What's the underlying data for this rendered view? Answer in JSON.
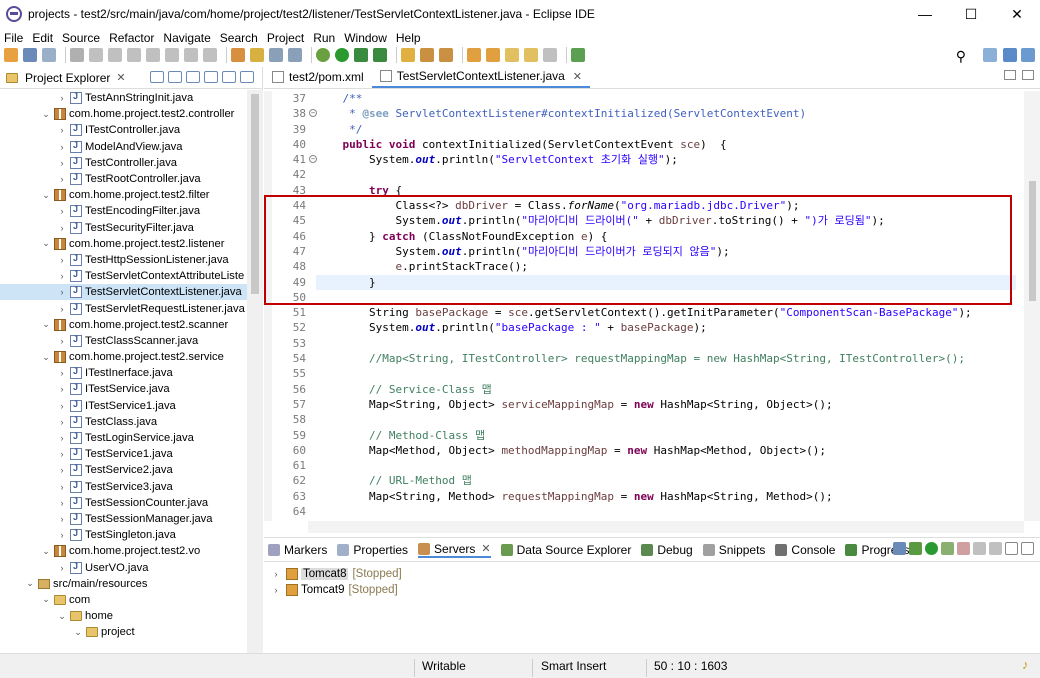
{
  "window": {
    "title": "projects - test2/src/main/java/com/home/project/test2/listener/TestServletContextListener.java - Eclipse IDE",
    "minimize": "—",
    "maximize": "☐",
    "close": "✕"
  },
  "menu": [
    "File",
    "Edit",
    "Source",
    "Refactor",
    "Navigate",
    "Search",
    "Project",
    "Run",
    "Window",
    "Help"
  ],
  "explorer": {
    "title": "Project Explorer",
    "items": [
      {
        "label": "TestAnnStringInit.java",
        "type": "java",
        "indent": 6,
        "twisty": "›"
      },
      {
        "label": "com.home.project.test2.controller",
        "type": "pkg",
        "indent": 4,
        "twisty": "⌄"
      },
      {
        "label": "ITestController.java",
        "type": "java",
        "indent": 6,
        "twisty": "›"
      },
      {
        "label": "ModelAndView.java",
        "type": "java",
        "indent": 6,
        "twisty": "›"
      },
      {
        "label": "TestController.java",
        "type": "java",
        "indent": 6,
        "twisty": "›"
      },
      {
        "label": "TestRootController.java",
        "type": "java",
        "indent": 6,
        "twisty": "›"
      },
      {
        "label": "com.home.project.test2.filter",
        "type": "pkg",
        "indent": 4,
        "twisty": "⌄"
      },
      {
        "label": "TestEncodingFilter.java",
        "type": "java",
        "indent": 6,
        "twisty": "›"
      },
      {
        "label": "TestSecurityFilter.java",
        "type": "java",
        "indent": 6,
        "twisty": "›"
      },
      {
        "label": "com.home.project.test2.listener",
        "type": "pkg",
        "indent": 4,
        "twisty": "⌄"
      },
      {
        "label": "TestHttpSessionListener.java",
        "type": "java",
        "indent": 6,
        "twisty": "›"
      },
      {
        "label": "TestServletContextAttributeListe",
        "type": "java",
        "indent": 6,
        "twisty": "›"
      },
      {
        "label": "TestServletContextListener.java",
        "type": "java",
        "indent": 6,
        "twisty": "›",
        "selected": true
      },
      {
        "label": "TestServletRequestListener.java",
        "type": "java",
        "indent": 6,
        "twisty": "›"
      },
      {
        "label": "com.home.project.test2.scanner",
        "type": "pkg",
        "indent": 4,
        "twisty": "⌄"
      },
      {
        "label": "TestClassScanner.java",
        "type": "java",
        "indent": 6,
        "twisty": "›"
      },
      {
        "label": "com.home.project.test2.service",
        "type": "pkg",
        "indent": 4,
        "twisty": "⌄"
      },
      {
        "label": "ITestInerface.java",
        "type": "java",
        "indent": 6,
        "twisty": "›"
      },
      {
        "label": "ITestService.java",
        "type": "java",
        "indent": 6,
        "twisty": "›"
      },
      {
        "label": "ITestService1.java",
        "type": "java",
        "indent": 6,
        "twisty": "›"
      },
      {
        "label": "TestClass.java",
        "type": "java",
        "indent": 6,
        "twisty": "›"
      },
      {
        "label": "TestLoginService.java",
        "type": "java",
        "indent": 6,
        "twisty": "›"
      },
      {
        "label": "TestService1.java",
        "type": "java",
        "indent": 6,
        "twisty": "›"
      },
      {
        "label": "TestService2.java",
        "type": "java",
        "indent": 6,
        "twisty": "›"
      },
      {
        "label": "TestService3.java",
        "type": "java",
        "indent": 6,
        "twisty": "›"
      },
      {
        "label": "TestSessionCounter.java",
        "type": "java",
        "indent": 6,
        "twisty": "›"
      },
      {
        "label": "TestSessionManager.java",
        "type": "java",
        "indent": 6,
        "twisty": "›"
      },
      {
        "label": "TestSingleton.java",
        "type": "java",
        "indent": 6,
        "twisty": "›"
      },
      {
        "label": "com.home.project.test2.vo",
        "type": "pkg",
        "indent": 4,
        "twisty": "⌄"
      },
      {
        "label": "UserVO.java",
        "type": "java",
        "indent": 6,
        "twisty": "›"
      },
      {
        "label": "src/main/resources",
        "type": "src",
        "indent": 2,
        "twisty": "⌄"
      },
      {
        "label": "com",
        "type": "folder",
        "indent": 4,
        "twisty": "⌄"
      },
      {
        "label": "home",
        "type": "folder",
        "indent": 6,
        "twisty": "⌄"
      },
      {
        "label": "project",
        "type": "folder",
        "indent": 8,
        "twisty": "⌄"
      }
    ]
  },
  "editor": {
    "tabs": [
      {
        "label": "test2/pom.xml",
        "active": false
      },
      {
        "label": "TestServletContextListener.java",
        "active": true
      }
    ],
    "line_numbers": [
      "37",
      "38",
      "39",
      "40",
      "41",
      "42",
      "43",
      "44",
      "45",
      "46",
      "47",
      "48",
      "49",
      "50",
      "51",
      "52",
      "53",
      "54",
      "55",
      "56",
      "57",
      "58",
      "59",
      "60",
      "61",
      "62",
      "63",
      "64"
    ],
    "fold_lines": [
      "38",
      "41"
    ],
    "current_line": "50"
  },
  "bottom": {
    "tabs": [
      "Markers",
      "Properties",
      "Servers",
      "Data Source Explorer",
      "Debug",
      "Snippets",
      "Console",
      "Progress"
    ],
    "active_tab": "Servers",
    "servers": [
      {
        "name": "Tomcat8",
        "status": "[Stopped]",
        "selected": true
      },
      {
        "name": "Tomcat9",
        "status": "[Stopped]",
        "selected": false
      }
    ]
  },
  "status": {
    "writable": "Writable",
    "insert": "Smart Insert",
    "position": "50 : 10 : 1603"
  },
  "colors": {
    "highlight_box": "#c00000",
    "keyword": "#7f0055",
    "string": "#2a00ff",
    "comment": "#3f7f5f"
  }
}
